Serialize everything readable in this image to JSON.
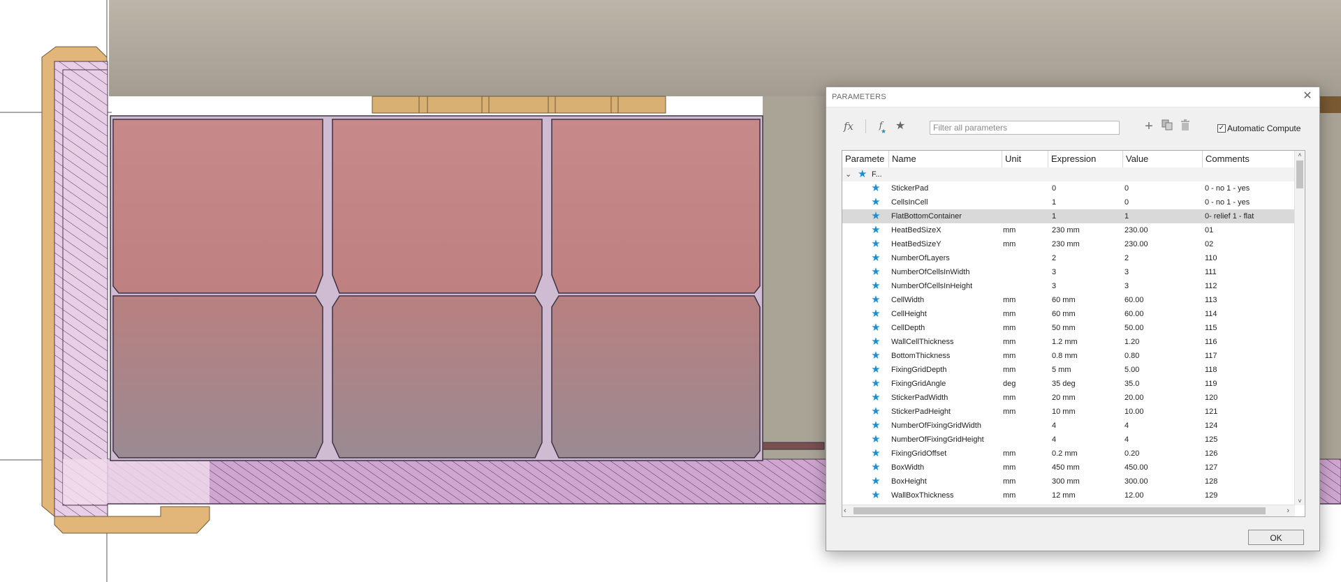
{
  "dialog": {
    "title": "PARAMETERS",
    "close_icon": "close-icon",
    "ok_label": "OK"
  },
  "toolbar": {
    "fx_icon": "fx",
    "fx_fav_icon": "f",
    "filter_placeholder": "Filter all parameters",
    "auto_compute_label": "Automatic Compute",
    "auto_compute_checked": true
  },
  "table": {
    "headers": {
      "parameter": "Paramete",
      "name": "Name",
      "unit": "Unit",
      "expression": "Expression",
      "value": "Value",
      "comments": "Comments"
    },
    "group": {
      "label": "F..."
    },
    "rows": [
      {
        "name": "StickerPad",
        "unit": "",
        "expression": "0",
        "value": "0",
        "comment": "0 - no 1 - yes"
      },
      {
        "name": "CellsInCell",
        "unit": "",
        "expression": "1",
        "value": "0",
        "comment": "0 - no 1 - yes"
      },
      {
        "name": "FlatBottomContainer",
        "unit": "",
        "expression": "1",
        "value": "1",
        "comment": "0- relief 1 - flat",
        "selected": true
      },
      {
        "name": "HeatBedSizeX",
        "unit": "mm",
        "expression": "230 mm",
        "value": "230.00",
        "comment": "01"
      },
      {
        "name": "HeatBedSizeY",
        "unit": "mm",
        "expression": "230 mm",
        "value": "230.00",
        "comment": "02"
      },
      {
        "name": "NumberOfLayers",
        "unit": "",
        "expression": "2",
        "value": "2",
        "comment": "110"
      },
      {
        "name": "NumberOfCellsInWidth",
        "unit": "",
        "expression": "3",
        "value": "3",
        "comment": "111"
      },
      {
        "name": "NumberOfCellsInHeight",
        "unit": "",
        "expression": "3",
        "value": "3",
        "comment": "112"
      },
      {
        "name": "CellWidth",
        "unit": "mm",
        "expression": "60 mm",
        "value": "60.00",
        "comment": "113"
      },
      {
        "name": "CellHeight",
        "unit": "mm",
        "expression": "60 mm",
        "value": "60.00",
        "comment": "114"
      },
      {
        "name": "CellDepth",
        "unit": "mm",
        "expression": "50 mm",
        "value": "50.00",
        "comment": "115"
      },
      {
        "name": "WallCellThickness",
        "unit": "mm",
        "expression": "1.2 mm",
        "value": "1.20",
        "comment": "116"
      },
      {
        "name": "BottomThickness",
        "unit": "mm",
        "expression": "0.8 mm",
        "value": "0.80",
        "comment": "117"
      },
      {
        "name": "FixingGridDepth",
        "unit": "mm",
        "expression": "5 mm",
        "value": "5.00",
        "comment": "118"
      },
      {
        "name": "FixingGridAngle",
        "unit": "deg",
        "expression": "35 deg",
        "value": "35.0",
        "comment": "119"
      },
      {
        "name": "StickerPadWidth",
        "unit": "mm",
        "expression": "20 mm",
        "value": "20.00",
        "comment": "120"
      },
      {
        "name": "StickerPadHeight",
        "unit": "mm",
        "expression": "10 mm",
        "value": "10.00",
        "comment": "121"
      },
      {
        "name": "NumberOfFixingGridWidth",
        "unit": "",
        "expression": "4",
        "value": "4",
        "comment": "124"
      },
      {
        "name": "NumberOfFixingGridHeight",
        "unit": "",
        "expression": "4",
        "value": "4",
        "comment": "125"
      },
      {
        "name": "FixingGridOffset",
        "unit": "mm",
        "expression": "0.2 mm",
        "value": "0.20",
        "comment": "126"
      },
      {
        "name": "BoxWidth",
        "unit": "mm",
        "expression": "450 mm",
        "value": "450.00",
        "comment": "127"
      },
      {
        "name": "BoxHeight",
        "unit": "mm",
        "expression": "300 mm",
        "value": "300.00",
        "comment": "128"
      },
      {
        "name": "WallBoxThickness",
        "unit": "mm",
        "expression": "12 mm",
        "value": "12.00",
        "comment": "129"
      }
    ]
  },
  "colors": {
    "accent_star": "#1a8fd1",
    "cell_fill": "#c48686",
    "hatch_fill": "#e7cde3",
    "wood": "#e0b675",
    "background_wall": "#b2aa9e"
  }
}
